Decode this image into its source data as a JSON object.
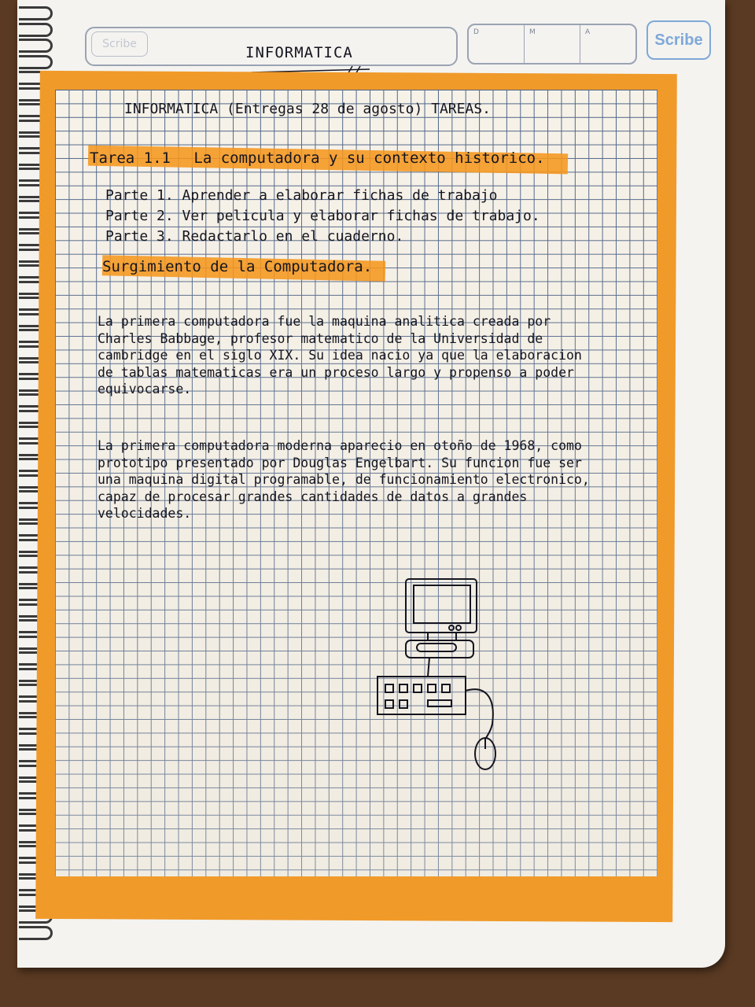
{
  "header": {
    "ghost_text": "Scribe",
    "date_labels": [
      "D",
      "M",
      "A"
    ],
    "brand": "Scribe"
  },
  "page_title": "INFORMATICA",
  "note_title": "INFORMATICA (Entregas 28 de agosto) TAREAS.",
  "task": {
    "label": "Tarea 1.1",
    "title": "La computadora y su contexto historico."
  },
  "parts": [
    "Parte 1. Aprender a elaborar fichas de trabajo",
    "Parte 2. Ver pelicula y elaborar fichas de trabajo.",
    "Parte 3. Redactarlo en el cuaderno."
  ],
  "subtitle": "Surgimiento de la Computadora.",
  "paragraphs": [
    "La primera computadora fue la maquina analitica creada por Charles Babbage, profesor matematico de la Universidad de cambridge en el siglo XIX. Su idea nacio ya que la elaboracion de tablas matematicas era un proceso largo y propenso a poder equivocarse.",
    "La primera computadora moderna aparecio en otoño de 1968, como prototipo presentado por Douglas Engelbart. Su funcion fue ser una maquina digital programable, de funcionamiento electronico, capaz de procesar grandes cantidades de datos a grandes velocidades."
  ],
  "colors": {
    "highlighter": "#f09a2a",
    "grid": "#3c5a86",
    "ink": "#15151f"
  },
  "drawing": "computer-drawing"
}
